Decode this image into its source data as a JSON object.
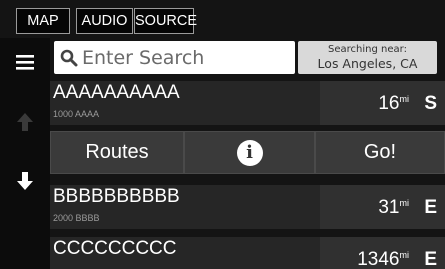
{
  "topbar": {
    "map": "MAP",
    "audio": "AUDIO",
    "source": "SOURCE"
  },
  "search": {
    "placeholder": "Enter Search",
    "near_label": "Searching near:",
    "near_value": "Los Angeles, CA"
  },
  "results": [
    {
      "name": "AAAAAAAAAA",
      "address": "1000 AAAA",
      "distance": "16",
      "unit": "mi",
      "direction": "S"
    },
    {
      "name": "BBBBBBBBBB",
      "address": "2000 BBBB",
      "distance": "31",
      "unit": "mi",
      "direction": "E"
    },
    {
      "name": "CCCCCCCCC",
      "address": "",
      "distance": "1346",
      "unit": "mi",
      "direction": "E"
    }
  ],
  "actions": {
    "routes": "Routes",
    "info": "i",
    "go": "Go!"
  },
  "icons": {
    "menu": "hamburger-icon",
    "up": "scroll-up-icon",
    "down": "scroll-down-icon",
    "search": "magnifier-icon"
  }
}
